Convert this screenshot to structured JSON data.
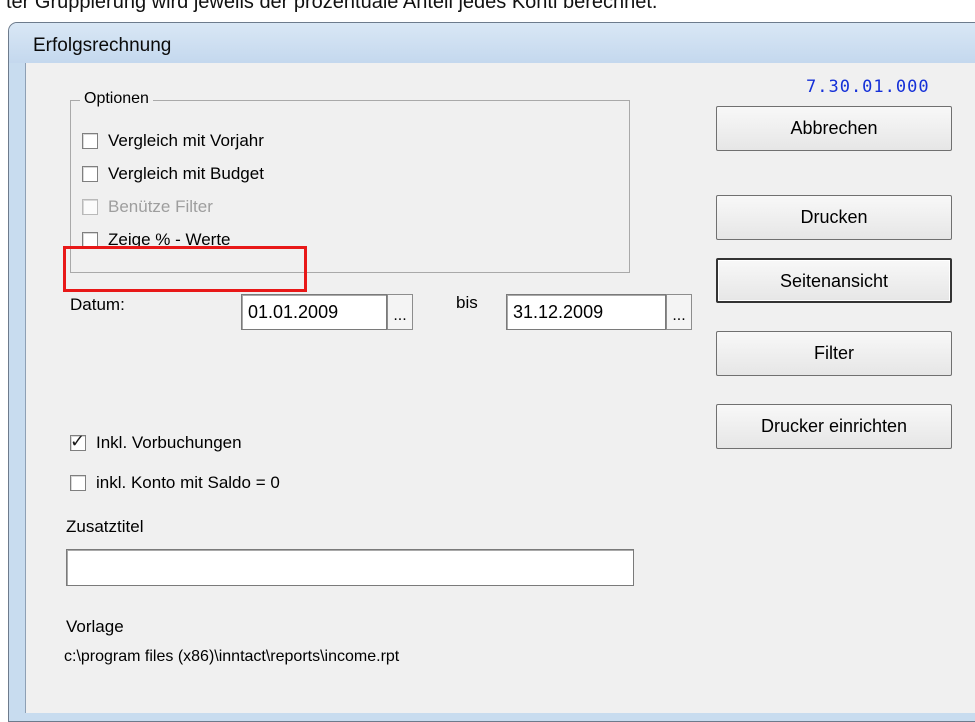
{
  "caption": "ter Gruppierung wird jeweils der prozentuale Anteil jedes Konti berechnet.",
  "window": {
    "title": "Erfolgsrechnung",
    "version": "7.30.01.000"
  },
  "options": {
    "legend": "Optionen",
    "items": [
      {
        "label": "Vergleich mit Vorjahr",
        "checked": false,
        "enabled": true
      },
      {
        "label": "Vergleich mit Budget",
        "checked": false,
        "enabled": true
      },
      {
        "label": "Benütze Filter",
        "checked": false,
        "enabled": false
      },
      {
        "label": "Zeige % - Werte",
        "checked": false,
        "enabled": true
      }
    ]
  },
  "date": {
    "label": "Datum:",
    "from": "01.01.2009",
    "to_label": "bis",
    "to": "31.12.2009",
    "picker_label": "..."
  },
  "extra_options": [
    {
      "label": "Inkl. Vorbuchungen",
      "checked": true
    },
    {
      "label": "inkl. Konto mit Saldo = 0",
      "checked": false
    }
  ],
  "additional_title": {
    "label": "Zusatztitel",
    "value": ""
  },
  "template": {
    "label": "Vorlage",
    "path": "c:\\program files (x86)\\inntact\\reports\\income.rpt"
  },
  "buttons": {
    "cancel": "Abbrechen",
    "print": "Drucken",
    "preview": "Seitenansicht",
    "filter": "Filter",
    "printer_setup": "Drucker einrichten"
  },
  "colors": {
    "version_text": "#1530d8",
    "highlight": "#e81818"
  }
}
